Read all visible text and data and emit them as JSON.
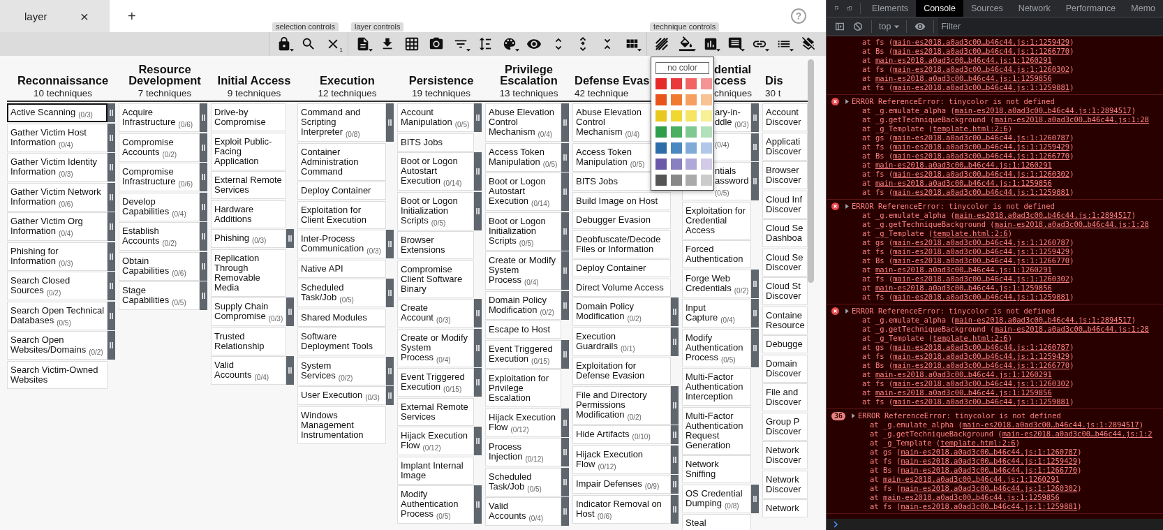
{
  "tabs": [
    {
      "label": "layer",
      "close": "×",
      "selected": true
    }
  ],
  "new_tab": "+",
  "help": "?",
  "toolbar": {
    "groups": [
      {
        "label": "selection controls"
      },
      {
        "label": "layer controls"
      },
      {
        "label": "technique controls"
      }
    ],
    "deselect_count": "1"
  },
  "matrix": {
    "tactics": [
      {
        "name": "Reconnaissance",
        "count": "10 techniques",
        "kind": "full",
        "techniques": [
          {
            "name": "Active Scanning",
            "count": "(0/3)",
            "selected": true
          },
          {
            "name": "Gather Victim Host Information",
            "count": "(0/4)",
            "selected": false
          },
          {
            "name": "Gather Victim Identity Information",
            "count": "(0/3)",
            "selected": false
          },
          {
            "name": "Gather Victim Network Information",
            "count": "(0/6)",
            "selected": false
          },
          {
            "name": "Gather Victim Org Information",
            "count": "(0/4)",
            "selected": false
          },
          {
            "name": "Phishing for Information",
            "count": "(0/3)",
            "selected": false
          },
          {
            "name": "Search Closed Sources",
            "count": "(0/2)",
            "selected": false
          },
          {
            "name": "Search Open Technical Databases",
            "count": "(0/5)",
            "selected": false
          },
          {
            "name": "Search Open Websites/Domains",
            "count": "(0/2)",
            "selected": false
          },
          {
            "name": "Search Victim-Owned Websites",
            "selected": false
          }
        ]
      },
      {
        "name": "Resource Development",
        "count": "7 techniques",
        "kind": "full",
        "techniques": [
          {
            "name": "Acquire Infrastructure",
            "count": "(0/6)",
            "selected": false
          },
          {
            "name": "Compromise Accounts",
            "count": "(0/2)",
            "selected": false
          },
          {
            "name": "Compromise Infrastructure",
            "count": "(0/6)",
            "selected": false
          },
          {
            "name": "Develop Capabilities",
            "count": "(0/4)",
            "selected": false
          },
          {
            "name": "Establish Accounts",
            "count": "(0/2)",
            "selected": false
          },
          {
            "name": "Obtain Capabilities",
            "count": "(0/6)",
            "selected": false
          },
          {
            "name": "Stage Capabilities",
            "count": "(0/5)",
            "selected": false
          }
        ]
      },
      {
        "name": "Initial Access",
        "count": "9 techniques",
        "kind": "full",
        "techniques": [
          {
            "name": "Drive-by Compromise",
            "selected": false
          },
          {
            "name": "Exploit Public-Facing Application",
            "selected": false
          },
          {
            "name": "External Remote Services",
            "selected": false
          },
          {
            "name": "Hardware Additions",
            "selected": false
          },
          {
            "name": "Phishing",
            "count": "(0/3)",
            "selected": false
          },
          {
            "name": "Replication Through Removable Media",
            "selected": false
          },
          {
            "name": "Supply Chain Compromise",
            "count": "(0/3)",
            "selected": false
          },
          {
            "name": "Trusted Relationship",
            "selected": false
          },
          {
            "name": "Valid Accounts",
            "count": "(0/4)",
            "selected": false
          }
        ]
      },
      {
        "name": "Execution",
        "count": "12 techniques",
        "kind": "full",
        "techniques": [
          {
            "name": "Command and Scripting Interpreter",
            "count": "(0/8)",
            "selected": false
          },
          {
            "name": "Container Administration Command",
            "selected": false
          },
          {
            "name": "Deploy Container",
            "selected": false
          },
          {
            "name": "Exploitation for Client Execution",
            "selected": false
          },
          {
            "name": "Inter-Process Communication",
            "count": "(0/3)",
            "selected": false
          },
          {
            "name": "Native API",
            "selected": false
          },
          {
            "name": "Scheduled Task/Job",
            "count": "(0/5)",
            "selected": false
          },
          {
            "name": "Shared Modules",
            "selected": false
          },
          {
            "name": "Software Deployment Tools",
            "selected": false
          },
          {
            "name": "System Services",
            "count": "(0/2)",
            "selected": false
          },
          {
            "name": "User Execution",
            "count": "(0/3)",
            "selected": false
          },
          {
            "name": "Windows Management Instrumentation",
            "selected": false
          }
        ]
      },
      {
        "name": "Persistence",
        "count": "19 techniques",
        "kind": "full",
        "techniques": [
          {
            "name": "Account Manipulation",
            "count": "(0/5)",
            "selected": false
          },
          {
            "name": "BITS Jobs",
            "selected": false
          },
          {
            "name": "Boot or Logon Autostart Execution",
            "count": "(0/14)",
            "selected": false
          },
          {
            "name": "Boot or Logon Initialization Scripts",
            "count": "(0/5)",
            "selected": false
          },
          {
            "name": "Browser Extensions",
            "selected": false
          },
          {
            "name": "Compromise Client Software Binary",
            "selected": false
          },
          {
            "name": "Create Account",
            "count": "(0/3)",
            "selected": false
          },
          {
            "name": "Create or Modify System Process",
            "count": "(0/4)",
            "selected": false
          },
          {
            "name": "Event Triggered Execution",
            "count": "(0/15)",
            "selected": false
          },
          {
            "name": "External Remote Services",
            "selected": false
          },
          {
            "name": "Hijack Execution Flow",
            "count": "(0/12)",
            "selected": false
          },
          {
            "name": "Implant Internal Image",
            "selected": false
          },
          {
            "name": "Modify Authentication Process",
            "count": "(0/5)",
            "selected": false
          }
        ]
      },
      {
        "name": "Privilege Escalation",
        "count": "13 techniques",
        "kind": "full",
        "techniques": [
          {
            "name": "Abuse Elevation Control Mechanism",
            "count": "(0/4)",
            "selected": false
          },
          {
            "name": "Access Token Manipulation",
            "count": "(0/5)",
            "selected": false
          },
          {
            "name": "Boot or Logon Autostart Execution",
            "count": "(0/14)",
            "selected": false
          },
          {
            "name": "Boot or Logon Initialization Scripts",
            "count": "(0/5)",
            "selected": false
          },
          {
            "name": "Create or Modify System Process",
            "count": "(0/4)",
            "selected": false
          },
          {
            "name": "Domain Policy Modification",
            "count": "(0/2)",
            "selected": false
          },
          {
            "name": "Escape to Host",
            "selected": false
          },
          {
            "name": "Event Triggered Execution",
            "count": "(0/15)",
            "selected": false
          },
          {
            "name": "Exploitation for Privilege Escalation",
            "selected": false
          },
          {
            "name": "Hijack Execution Flow",
            "count": "(0/12)",
            "selected": false
          },
          {
            "name": "Process Injection",
            "count": "(0/12)",
            "selected": false
          },
          {
            "name": "Scheduled Task/Job",
            "count": "(0/5)",
            "selected": false
          },
          {
            "name": "Valid Accounts",
            "count": "(0/4)",
            "selected": false
          }
        ]
      },
      {
        "name": "Defense Evas",
        "count": "42 technique",
        "kind": "cut-right",
        "techniques": [
          {
            "name": "Abuse Elevation Control Mechanism",
            "count": "(0/4)",
            "selected": false
          },
          {
            "name": "Access Token Manipulation",
            "count": "(0/5)",
            "selected": false
          },
          {
            "name": "BITS Jobs",
            "selected": false
          },
          {
            "name": "Build Image on Host",
            "selected": false
          },
          {
            "name": "Debugger Evasion",
            "selected": false
          },
          {
            "name": "Deobfuscate/Decode Files or Information",
            "selected": false
          },
          {
            "name": "Deploy Container",
            "selected": false
          },
          {
            "name": "Direct Volume Access",
            "selected": false
          },
          {
            "name": "Domain Policy Modification",
            "count": "(0/2)",
            "selected": false
          },
          {
            "name": "Execution Guardrails",
            "count": "(0/1)",
            "selected": false
          },
          {
            "name": "Exploitation for Defense Evasion",
            "selected": false
          },
          {
            "name": "File and Directory Permissions Modification",
            "count": "(0/2)",
            "selected": false
          },
          {
            "name": "Hide Artifacts",
            "count": "(0/10)",
            "selected": false
          },
          {
            "name": "Hijack Execution Flow",
            "count": "(0/12)",
            "selected": false
          },
          {
            "name": "Impair Defenses",
            "count": "(0/9)",
            "selected": false
          },
          {
            "name": "Indicator Removal on Host",
            "count": "(0/6)",
            "selected": false
          }
        ]
      },
      {
        "name": "dential ccess",
        "count": "chniques",
        "kind": "cut-left",
        "techniques": [
          {
            "kind": "covered",
            "name": "ary-in- ddle",
            "count": "(0/3)",
            "selected": false
          },
          {
            "kind": "covered",
            "count": "(0/4)",
            "selected": false
          },
          {
            "kind": "covered",
            "name": "ntials assword",
            "count": "(0/5)",
            "selected": false
          },
          {
            "kind": "plain",
            "name": "Exploitation for Credential Access",
            "selected": false
          },
          {
            "kind": "plain",
            "name": "Forced Authentication",
            "selected": false
          },
          {
            "kind": "plain",
            "name": "Forge Web Credentials",
            "count": "(0/2)",
            "selected": false
          },
          {
            "kind": "plain",
            "name": "Input Capture",
            "count": "(0/4)",
            "selected": false
          },
          {
            "kind": "plain",
            "name": "Modify Authentication Process",
            "count": "(0/5)",
            "selected": false
          },
          {
            "kind": "plain",
            "name": "Multi-Factor Authentication Interception",
            "selected": false
          },
          {
            "kind": "plain",
            "name": "Multi-Factor Authentication Request Generation",
            "selected": false
          },
          {
            "kind": "plain",
            "name": "Network Sniffing",
            "selected": false
          },
          {
            "kind": "plain",
            "name": "OS Credential Dumping",
            "count": "(0/8)",
            "selected": false
          },
          {
            "kind": "plain",
            "name": "Steal",
            "selected": false
          }
        ]
      },
      {
        "name": "Dis",
        "count": "30 t",
        "kind": "cut-edge",
        "techniques": [
          {
            "name": "Account Discover",
            "selected": false
          },
          {
            "name": "Applicati Discover",
            "selected": false
          },
          {
            "name": "Browser Discover",
            "selected": false
          },
          {
            "name": "Cloud Inf Discover",
            "selected": false
          },
          {
            "name": "Cloud Se Dashboa",
            "selected": false
          },
          {
            "name": "Cloud Se Discover",
            "selected": false
          },
          {
            "name": "Cloud St Discover",
            "selected": false
          },
          {
            "name": "Containe Resource",
            "selected": false
          },
          {
            "name": "Debugge",
            "selected": false
          },
          {
            "name": "Domain Discover",
            "selected": false
          },
          {
            "name": "File and Discover",
            "selected": false
          },
          {
            "name": "Group P Discover",
            "selected": false
          },
          {
            "name": "Network Discover",
            "selected": false
          },
          {
            "name": "Network Discover",
            "selected": false
          },
          {
            "name": "Network",
            "selected": false
          }
        ]
      }
    ]
  },
  "color_picker": {
    "no_color": "no color",
    "swatches": [
      {
        "color": "#e62a2a"
      },
      {
        "color": "#e83a3a"
      },
      {
        "color": "#f06464"
      },
      {
        "color": "#f59494"
      },
      {
        "color": "#e8541c"
      },
      {
        "color": "#f07a30"
      },
      {
        "color": "#f5a062"
      },
      {
        "color": "#f8c394"
      },
      {
        "color": "#e8c81c"
      },
      {
        "color": "#f0d832"
      },
      {
        "color": "#f5e562"
      },
      {
        "color": "#f8f094"
      },
      {
        "color": "#2e9e4a"
      },
      {
        "color": "#4cb062"
      },
      {
        "color": "#80c892"
      },
      {
        "color": "#b2e0ba"
      },
      {
        "color": "#2e6ea8"
      },
      {
        "color": "#4a88c0"
      },
      {
        "color": "#80aad8"
      },
      {
        "color": "#b2c8e8"
      },
      {
        "color": "#6a5aa8"
      },
      {
        "color": "#8880c0"
      },
      {
        "color": "#b0a8d8"
      },
      {
        "color": "#d2cae8"
      },
      {
        "color": "#555555"
      },
      {
        "color": "#888888"
      },
      {
        "color": "#aaaaaa"
      },
      {
        "color": "#cccccc"
      }
    ]
  },
  "devtools": {
    "tabs": [
      {
        "label": "Elements",
        "selected": false
      },
      {
        "label": "Console",
        "selected": true
      },
      {
        "label": "Sources",
        "selected": false
      },
      {
        "label": "Network",
        "selected": false
      },
      {
        "label": "Performance",
        "selected": false
      },
      {
        "label": "Memo",
        "selected": false
      }
    ],
    "context": "top",
    "filter": {
      "placeholder": "Filter"
    },
    "messages": [
      {
        "kind": "trace",
        "lines": [
          {
            "text": "at fs (",
            "link": "main-es2018.a0ad3c00…b46c44.js:1:1259429",
            "end": ")"
          },
          {
            "text": "at Bs (",
            "link": "main-es2018.a0ad3c00…b46c44.js:1:1266770",
            "end": ")"
          },
          {
            "text": "at ",
            "link": "main-es2018.a0ad3c00…b46c44.js:1:1260291"
          },
          {
            "text": "at fs (",
            "link": "main-es2018.a0ad3c00…b46c44.js:1:1260302",
            "end": ")"
          },
          {
            "text": "at ",
            "link": "main-es2018.a0ad3c00…b46c44.js:1:1259856"
          },
          {
            "text": "at fs (",
            "link": "main-es2018.a0ad3c00…b46c44.js:1:1259881",
            "end": ")"
          }
        ]
      },
      {
        "kind": "error",
        "text": "ERROR ReferenceError: tinycolor is not defined",
        "lines": [
          {
            "text": "at _g.emulate_alpha (",
            "link": "main-es2018.a0ad3c00…b46c44.js:1:2894517",
            "end": ")"
          },
          {
            "text": "at _g.getTechniqueBackground (",
            "link": "main-es2018.a0ad3c00…b46c44.js:1:28"
          },
          {
            "text": "at _g_Template (",
            "link": "template.html:2:6",
            "end": ")"
          },
          {
            "text": "at gs (",
            "link": "main-es2018.a0ad3c00…b46c44.js:1:1260787",
            "end": ")"
          },
          {
            "text": "at fs (",
            "link": "main-es2018.a0ad3c00…b46c44.js:1:1259429",
            "end": ")"
          },
          {
            "text": "at Bs (",
            "link": "main-es2018.a0ad3c00…b46c44.js:1:1266770",
            "end": ")"
          },
          {
            "text": "at ",
            "link": "main-es2018.a0ad3c00…b46c44.js:1:1260291"
          },
          {
            "text": "at fs (",
            "link": "main-es2018.a0ad3c00…b46c44.js:1:1260302",
            "end": ")"
          },
          {
            "text": "at ",
            "link": "main-es2018.a0ad3c00…b46c44.js:1:1259856"
          },
          {
            "text": "at fs (",
            "link": "main-es2018.a0ad3c00…b46c44.js:1:1259881",
            "end": ")"
          }
        ]
      },
      {
        "kind": "error",
        "text": "ERROR ReferenceError: tinycolor is not defined",
        "lines": [
          {
            "text": "at _g.emulate_alpha (",
            "link": "main-es2018.a0ad3c00…b46c44.js:1:2894517",
            "end": ")"
          },
          {
            "text": "at _g.getTechniqueBackground (",
            "link": "main-es2018.a0ad3c00…b46c44.js:1:28"
          },
          {
            "text": "at _g_Template (",
            "link": "template.html:2:6",
            "end": ")"
          },
          {
            "text": "at gs (",
            "link": "main-es2018.a0ad3c00…b46c44.js:1:1260787",
            "end": ")"
          },
          {
            "text": "at fs (",
            "link": "main-es2018.a0ad3c00…b46c44.js:1:1259429",
            "end": ")"
          },
          {
            "text": "at Bs (",
            "link": "main-es2018.a0ad3c00…b46c44.js:1:1266770",
            "end": ")"
          },
          {
            "text": "at ",
            "link": "main-es2018.a0ad3c00…b46c44.js:1:1260291"
          },
          {
            "text": "at fs (",
            "link": "main-es2018.a0ad3c00…b46c44.js:1:1260302",
            "end": ")"
          },
          {
            "text": "at ",
            "link": "main-es2018.a0ad3c00…b46c44.js:1:1259856"
          },
          {
            "text": "at fs (",
            "link": "main-es2018.a0ad3c00…b46c44.js:1:1259881",
            "end": ")"
          }
        ]
      },
      {
        "kind": "error",
        "text": "ERROR ReferenceError: tinycolor is not defined",
        "lines": [
          {
            "text": "at _g.emulate_alpha (",
            "link": "main-es2018.a0ad3c00…b46c44.js:1:2894517",
            "end": ")"
          },
          {
            "text": "at _g.getTechniqueBackground (",
            "link": "main-es2018.a0ad3c00…b46c44.js:1:28"
          },
          {
            "text": "at _g_Template (",
            "link": "template.html:2:6",
            "end": ")"
          },
          {
            "text": "at gs (",
            "link": "main-es2018.a0ad3c00…b46c44.js:1:1260787",
            "end": ")"
          },
          {
            "text": "at fs (",
            "link": "main-es2018.a0ad3c00…b46c44.js:1:1259429",
            "end": ")"
          },
          {
            "text": "at Bs (",
            "link": "main-es2018.a0ad3c00…b46c44.js:1:1266770",
            "end": ")"
          },
          {
            "text": "at ",
            "link": "main-es2018.a0ad3c00…b46c44.js:1:1260291"
          },
          {
            "text": "at fs (",
            "link": "main-es2018.a0ad3c00…b46c44.js:1:1260302",
            "end": ")"
          },
          {
            "text": "at ",
            "link": "main-es2018.a0ad3c00…b46c44.js:1:1259856"
          },
          {
            "text": "at fs (",
            "link": "main-es2018.a0ad3c00…b46c44.js:1:1259881",
            "end": ")"
          }
        ]
      },
      {
        "kind": "error",
        "repeat": "36",
        "text": "ERROR ReferenceError: tinycolor is not defined",
        "lines": [
          {
            "text": "at _g.emulate_alpha (",
            "link": "main-es2018.a0ad3c00…b46c44.js:1:2894517",
            "end": ")"
          },
          {
            "text": "at _g.getTechniqueBackground (",
            "link": "main-es2018.a0ad3c00…b46c44.js:1:2"
          },
          {
            "text": "at _g_Template (",
            "link": "template.html:2:6",
            "end": ")"
          },
          {
            "text": "at gs (",
            "link": "main-es2018.a0ad3c00…b46c44.js:1:1260787",
            "end": ")"
          },
          {
            "text": "at fs (",
            "link": "main-es2018.a0ad3c00…b46c44.js:1:1259429",
            "end": ")"
          },
          {
            "text": "at Bs (",
            "link": "main-es2018.a0ad3c00…b46c44.js:1:1266770",
            "end": ")"
          },
          {
            "text": "at ",
            "link": "main-es2018.a0ad3c00…b46c44.js:1:1260291"
          },
          {
            "text": "at fs (",
            "link": "main-es2018.a0ad3c00…b46c44.js:1:1260302",
            "end": ")"
          },
          {
            "text": "at ",
            "link": "main-es2018.a0ad3c00…b46c44.js:1:1259856"
          },
          {
            "text": "at fs (",
            "link": "main-es2018.a0ad3c00…b46c44.js:1:1259881",
            "end": ")"
          }
        ]
      }
    ]
  }
}
